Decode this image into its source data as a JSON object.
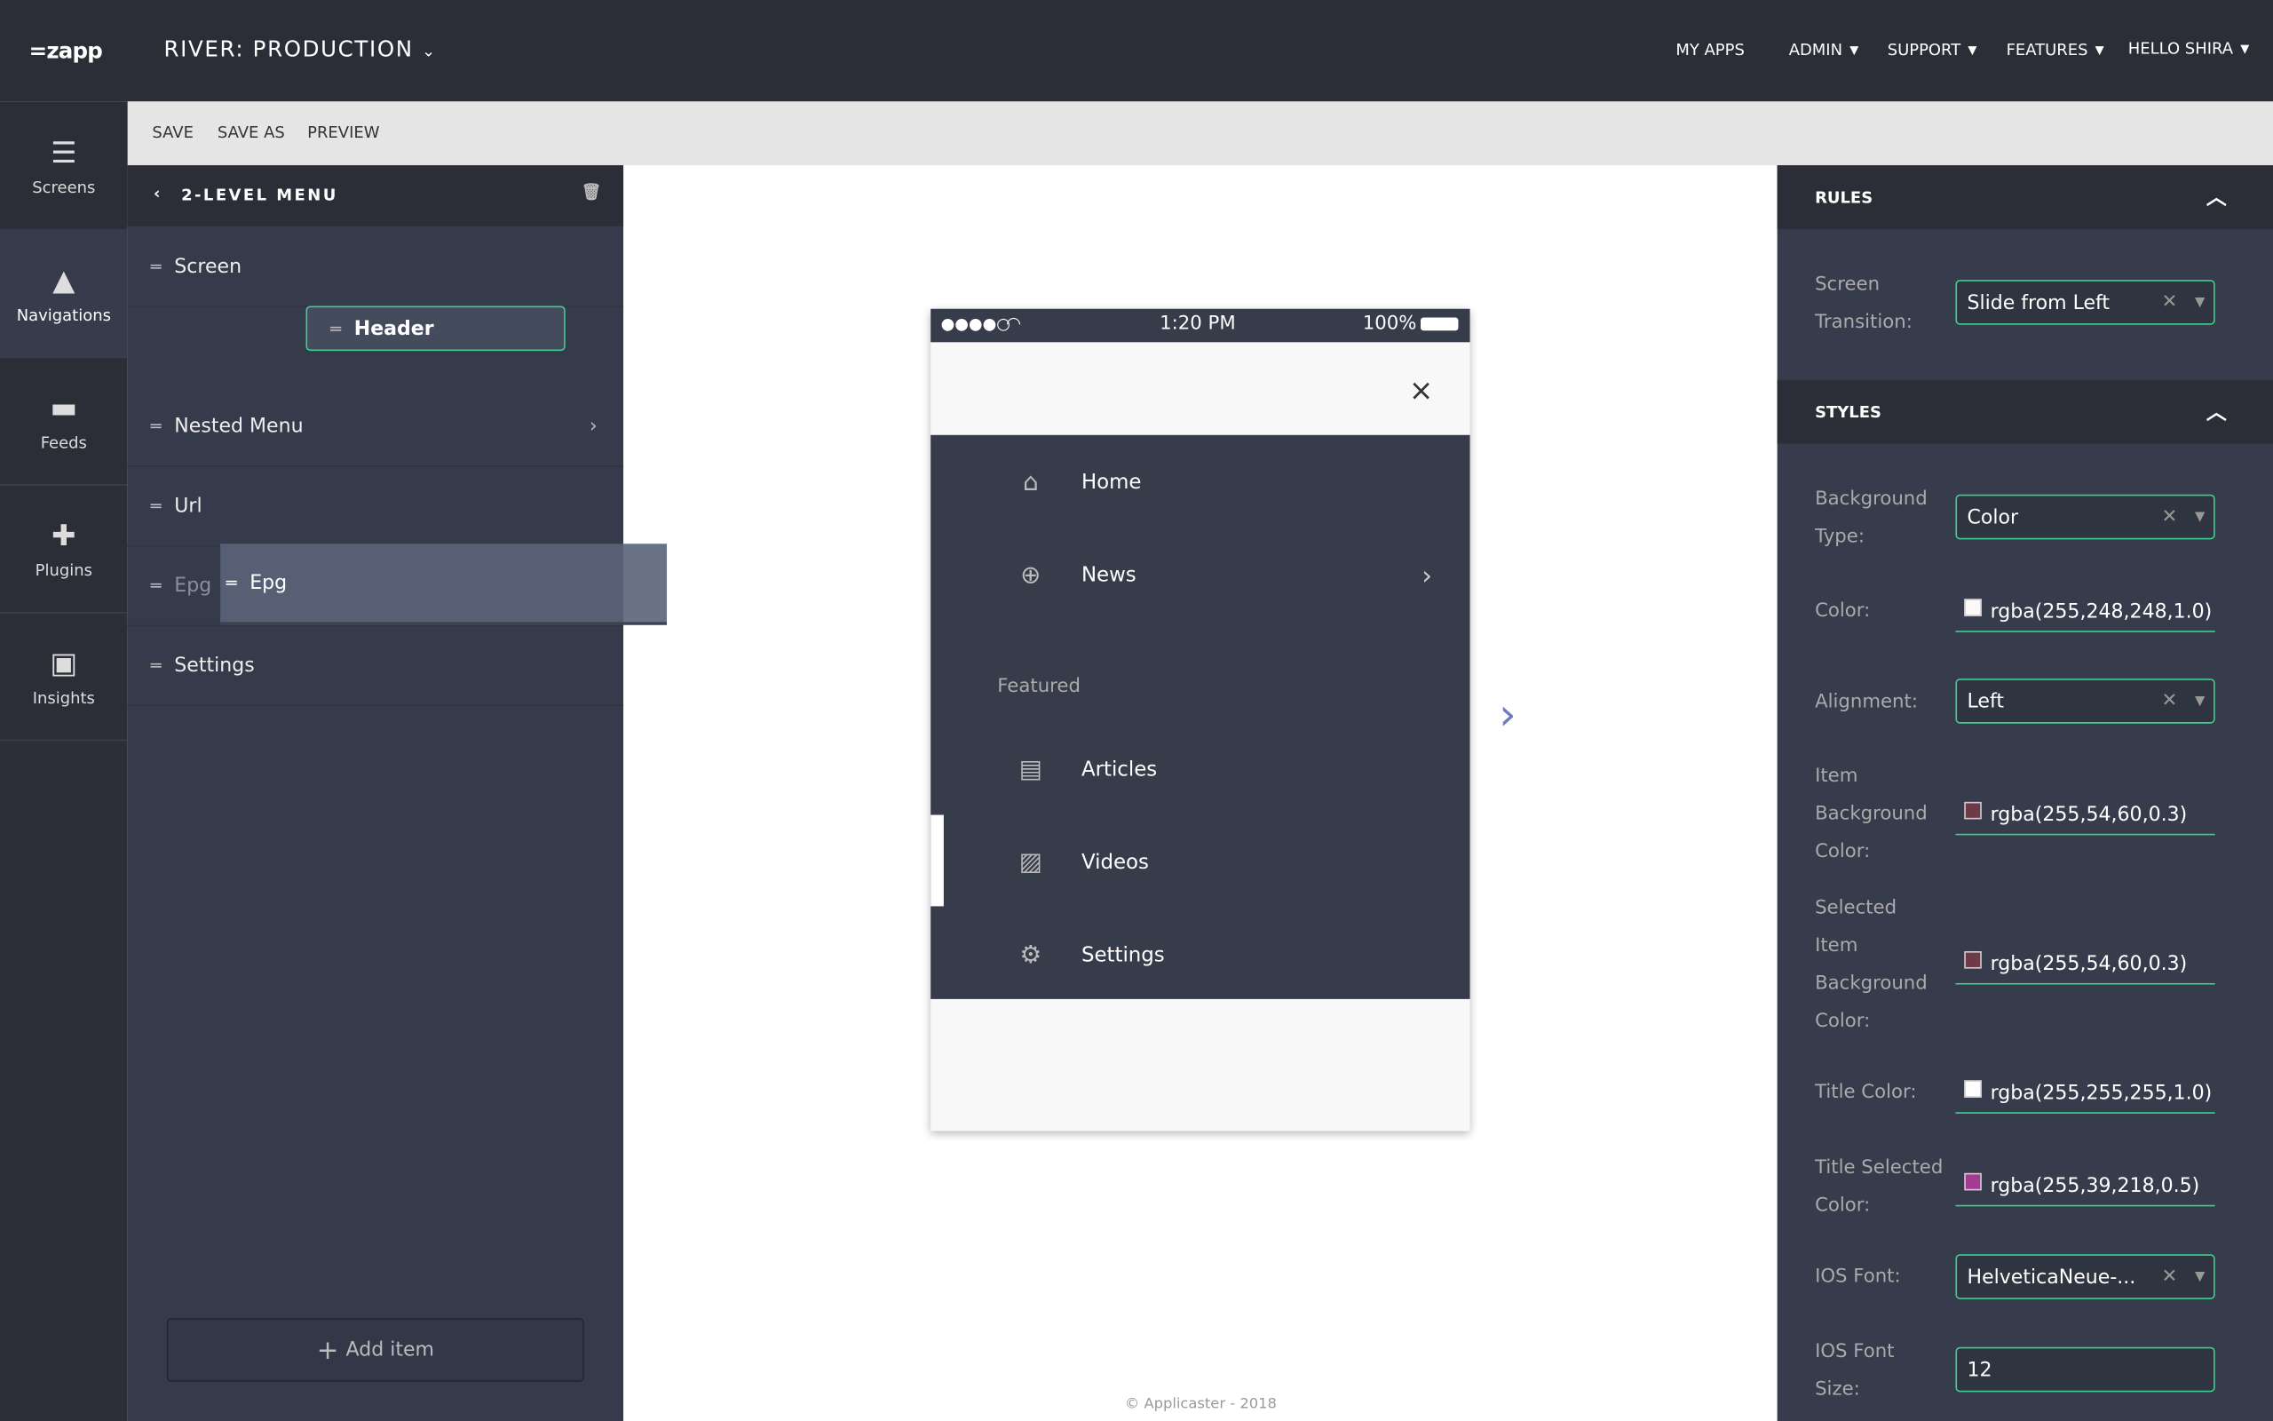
{
  "header": {
    "logo": "=zapp",
    "app_title": "RIVER: PRODUCTION",
    "nav": [
      "MY APPS",
      "ADMIN",
      "SUPPORT",
      "FEATURES",
      "HELLO SHIRA"
    ]
  },
  "toolbar": {
    "save": "SAVE",
    "save_as": "SAVE AS",
    "preview": "PREVIEW"
  },
  "rail": [
    {
      "label": "Screens",
      "icon": "screens-icon"
    },
    {
      "label": "Navigations",
      "icon": "navigation-arrow-icon"
    },
    {
      "label": "Feeds",
      "icon": "folder-icon"
    },
    {
      "label": "Plugins",
      "icon": "puzzle-icon"
    },
    {
      "label": "Insights",
      "icon": "chart-icon"
    }
  ],
  "left_panel": {
    "title": "2-LEVEL MENU",
    "items": [
      "Screen",
      "Header",
      "Nested Menu",
      "Url",
      "Epg",
      "Settings"
    ],
    "dragging": "Epg",
    "add_item": "Add item"
  },
  "phone": {
    "signal": "●●●●○",
    "time": "1:20 PM",
    "battery": "100%",
    "menu": [
      {
        "label": "Home",
        "icon": "home-icon"
      },
      {
        "label": "News",
        "icon": "globe-icon"
      },
      {
        "section": "Featured"
      },
      {
        "label": "Articles",
        "icon": "articles-icon"
      },
      {
        "label": "Videos",
        "icon": "image-icon"
      },
      {
        "label": "Settings",
        "icon": "gear-icon"
      }
    ]
  },
  "right_panel": {
    "rules_title": "RULES",
    "styles_title": "STYLES",
    "screen_transition_label": "Screen Transition:",
    "screen_transition": "Slide from Left",
    "background_type_label": "Background Type:",
    "background_type": "Color",
    "color_label": "Color:",
    "color": "rgba(255,248,248,1.0)",
    "alignment_label": "Alignment:",
    "alignment": "Left",
    "item_bg_label": "Item Background Color:",
    "item_bg": "rgba(255,54,60,0.3)",
    "sel_item_bg_label": "Selected Item Background Color:",
    "sel_item_bg": "rgba(255,54,60,0.3)",
    "title_color_label": "Title Color:",
    "title_color": "rgba(255,255,255,1.0)",
    "title_sel_color_label": "Title Selected Color:",
    "title_sel_color": "rgba(255,39,218,0.5)",
    "ios_font_label": "IOS Font:",
    "ios_font": "HelveticaNeue-...",
    "ios_font_size_label": "IOS Font Size:",
    "ios_font_size": "12"
  },
  "colors": {
    "accent": "#3ccf8e",
    "topbar": "#2b2e37",
    "panel": "#363c4b"
  },
  "footer": "© Applicaster - 2018"
}
